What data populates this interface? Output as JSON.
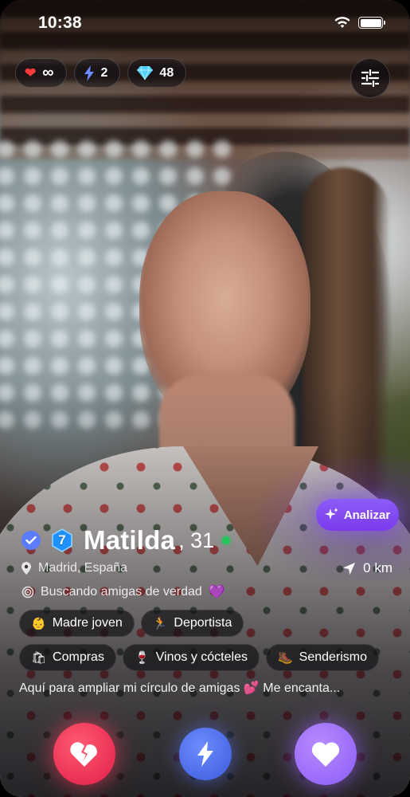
{
  "status_bar": {
    "time": "10:38",
    "icons": [
      "wifi-icon",
      "battery-icon"
    ]
  },
  "counters": {
    "lives": {
      "icon": "heart-icon",
      "value": "∞",
      "color": "#ff3b3b"
    },
    "boosts": {
      "icon": "bolt-icon",
      "value": "2",
      "color": "#6c8bff"
    },
    "gems": {
      "icon": "diamond-icon",
      "value": "48",
      "color": "#4fd2ff"
    }
  },
  "filter_button": {
    "icon": "sliders-icon"
  },
  "analyze_button": {
    "label": "Analizar",
    "icon": "sparkle-icon"
  },
  "profile": {
    "verified_icon": "verified-check-icon",
    "level": "7",
    "name": "Matilda",
    "age": ", 31",
    "online": true,
    "location": "Madrid, España",
    "distance": "0 km",
    "looking_for": "Buscando amigas de verdad",
    "looking_for_emoji": "💜",
    "tags_row1": [
      {
        "emoji": "👶",
        "label": "Madre joven"
      },
      {
        "emoji": "🏃",
        "label": "Deportista"
      }
    ],
    "tags_row2": [
      {
        "emoji": "🛍",
        "label": "Compras"
      },
      {
        "emoji": "🍷",
        "label": "Vinos y cócteles"
      },
      {
        "emoji": "🥾",
        "label": "Senderismo"
      }
    ],
    "bio": "Aquí para ampliar mi círculo de amigas 💕  Me encanta..."
  },
  "actions": {
    "dislike": {
      "icon": "broken-heart-icon",
      "color": "#e11d48"
    },
    "boost": {
      "icon": "bolt-icon",
      "color": "#3b5bdb"
    },
    "like": {
      "icon": "heart-icon",
      "color": "#8b5cf6"
    }
  },
  "colors": {
    "accent_purple": "#7c3aed",
    "online_green": "#22c55e"
  }
}
